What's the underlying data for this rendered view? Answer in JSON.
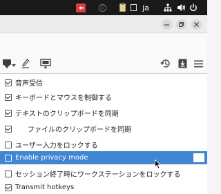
{
  "system_bar": {
    "language": "ja",
    "icons": [
      "remote-desktop-icon",
      "s-status-icon",
      "clipboard-icon",
      "message-icon",
      "network-icon",
      "volume-icon",
      "power-icon"
    ]
  },
  "window": {
    "buttons": [
      "minimize-icon",
      "restore-icon",
      "close-icon"
    ]
  },
  "toolbar": {
    "left_icons": [
      "shield-icon",
      "pen-icon",
      "monitor-icon"
    ],
    "right_icons": [
      "history-icon",
      "download-icon",
      "hamburger-menu-icon"
    ]
  },
  "menu": {
    "items": [
      {
        "label": "音声受信",
        "checked": true,
        "indent": false,
        "highlighted": false
      },
      {
        "label": "キーボードとマウスを制御する",
        "checked": true,
        "indent": false,
        "highlighted": false
      },
      {
        "label": "テキストのクリップボードを同期",
        "checked": true,
        "indent": false,
        "highlighted": false
      },
      {
        "label": "ファイルのクリップボードを同期",
        "checked": true,
        "indent": true,
        "highlighted": false
      },
      {
        "label": "ユーザー入力をロックする",
        "checked": false,
        "indent": false,
        "highlighted": false
      },
      {
        "label": "Enable privacy mode",
        "checked": false,
        "indent": false,
        "highlighted": true
      },
      {
        "label": "セッション終了時にワークステーションをロックする",
        "checked": false,
        "indent": false,
        "highlighted": false
      },
      {
        "label": "Transmit hotkeys",
        "checked": true,
        "indent": false,
        "highlighted": false
      }
    ]
  },
  "colors": {
    "system_bar": "#1a1a1a",
    "highlight": "#3f86d3",
    "remote_icon": "#e23b3b"
  }
}
